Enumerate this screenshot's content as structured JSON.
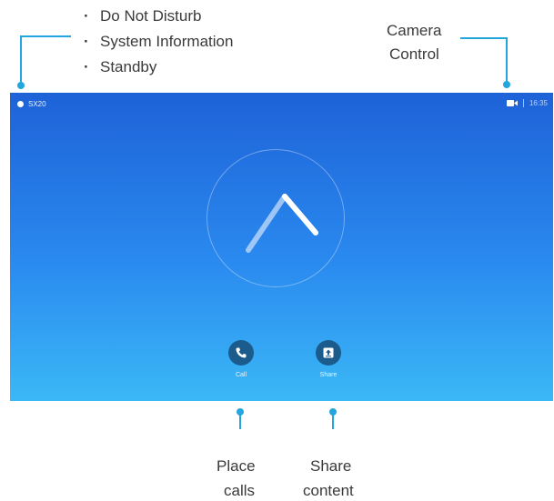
{
  "annotations": {
    "top_left_bullets": [
      "Do Not Disturb",
      "System Information",
      "Standby"
    ],
    "camera_control_line1": "Camera",
    "camera_control_line2": "Control",
    "place_calls_line1": "Place",
    "place_calls_line2": "calls",
    "share_content_line1": "Share",
    "share_content_line2": "content"
  },
  "status_bar": {
    "system_name": "SX20",
    "clock": "16:35",
    "camera_icon": "video-camera-icon",
    "info_icon": "info-dot-icon"
  },
  "actions": {
    "call_label": "Call",
    "call_icon": "phone-icon",
    "share_label": "Share",
    "share_icon": "share-upload-icon"
  },
  "colors": {
    "accent": "#22a6dd",
    "screen_top": "#1e62d8",
    "screen_bottom": "#3bb8f6",
    "button": "#1b5c8c"
  }
}
